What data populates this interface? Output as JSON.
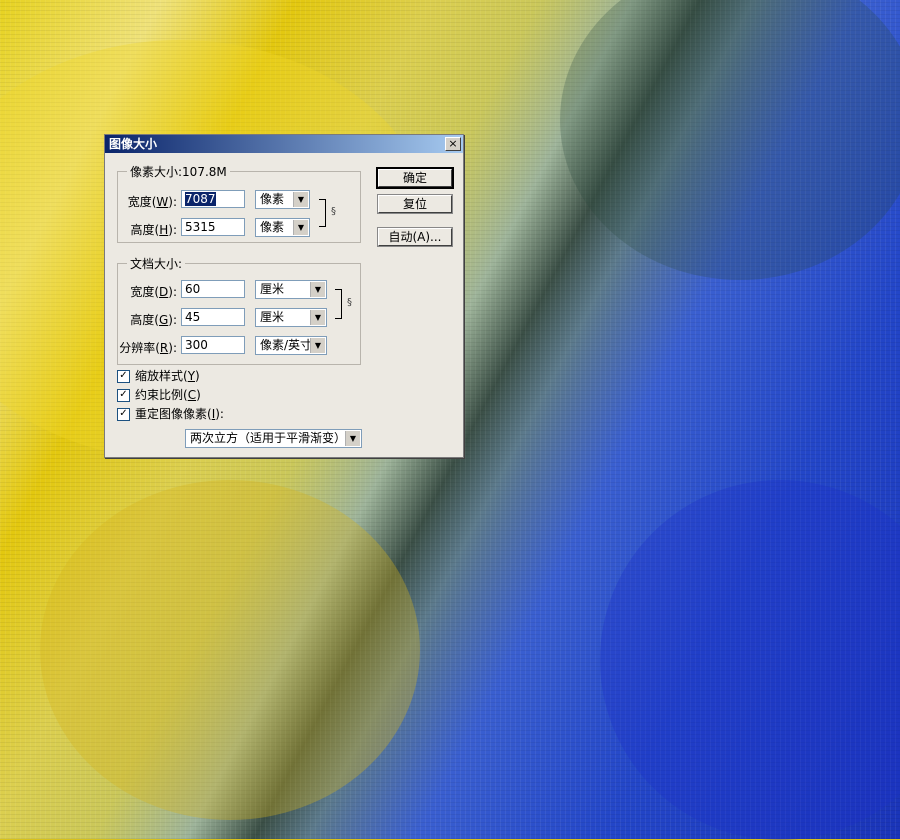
{
  "dialog": {
    "title": "图像大小",
    "close_symbol": "×"
  },
  "pixel_dimensions": {
    "legend": "像素大小:107.8M",
    "width_label_pre": "宽度(",
    "width_label_key": "W",
    "width_label_post": "):",
    "width_value": "7087",
    "width_unit": "像素",
    "height_label_pre": "高度(",
    "height_label_key": "H",
    "height_label_post": "):",
    "height_value": "5315",
    "height_unit": "像素"
  },
  "document_size": {
    "legend": "文档大小:",
    "width_label_pre": "宽度(",
    "width_label_key": "D",
    "width_label_post": "):",
    "width_value": "60",
    "width_unit": "厘米",
    "height_label_pre": "高度(",
    "height_label_key": "G",
    "height_label_post": "):",
    "height_value": "45",
    "height_unit": "厘米",
    "resolution_label_pre": "分辨率(",
    "resolution_label_key": "R",
    "resolution_label_post": "):",
    "resolution_value": "300",
    "resolution_unit": "像素/英寸"
  },
  "buttons": {
    "ok": "确定",
    "reset": "复位",
    "auto": "自动(A)..."
  },
  "options": {
    "scale_styles_pre": "缩放样式(",
    "scale_styles_key": "Y",
    "scale_styles_post": ")",
    "constrain_pre": "约束比例(",
    "constrain_key": "C",
    "constrain_post": ")",
    "resample_pre": "重定图像像素(",
    "resample_key": "I",
    "resample_post": "):",
    "resample_method": "两次立方（适用于平滑渐变）",
    "check_mark": "✓"
  },
  "icons": {
    "link": "chain-link-icon",
    "dropdown": "chevron-down-icon"
  }
}
